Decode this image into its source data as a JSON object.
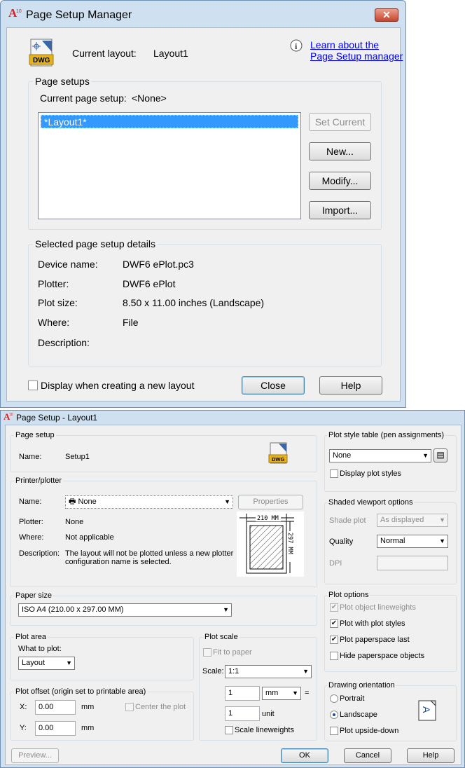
{
  "page_setup_manager": {
    "title": "Page Setup Manager",
    "close_glyph": "✕",
    "file_icon_text": "DWG",
    "current_layout_label": "Current layout:",
    "current_layout_value": "Layout1",
    "learn_link_line1": "Learn about the",
    "learn_link_line2": "Page Setup manager",
    "page_setups_legend": "Page setups",
    "current_page_setup_label": "Current page setup:",
    "current_page_setup_value": "<None>",
    "list_items": [
      "*Layout1*"
    ],
    "buttons": {
      "set_current": "Set Current",
      "new": "New...",
      "modify": "Modify...",
      "import": "Import..."
    },
    "details_legend": "Selected page setup details",
    "details": {
      "device_name_label": "Device name:",
      "device_name_value": "DWF6 ePlot.pc3",
      "plotter_label": "Plotter:",
      "plotter_value": "DWF6 ePlot",
      "plot_size_label": "Plot size:",
      "plot_size_value": "8.50 x 11.00 inches (Landscape)",
      "where_label": "Where:",
      "where_value": "File",
      "description_label": "Description:",
      "description_value": ""
    },
    "display_checkbox_label": "Display when creating a new layout",
    "close_button": "Close",
    "help_button": "Help"
  },
  "page_setup": {
    "title": "Page Setup - Layout1",
    "page_setup_group": {
      "legend": "Page setup",
      "name_label": "Name:",
      "name_value": "Setup1",
      "icon_text": "DWG"
    },
    "printer_plotter_group": {
      "legend": "Printer/plotter",
      "name_label": "Name:",
      "name_value": "None",
      "properties_button": "Properties",
      "plotter_label": "Plotter:",
      "plotter_value": "None",
      "where_label": "Where:",
      "where_value": "Not applicable",
      "description_label": "Description:",
      "description_line1": "The layout will not be plotted unless a new plotter",
      "description_line2": "configuration name is selected.",
      "preview_width": "210 MM",
      "preview_height": "297 MM"
    },
    "paper_size_group": {
      "legend": "Paper size",
      "value": "ISO A4 (210.00 x 297.00 MM)"
    },
    "plot_area_group": {
      "legend": "Plot area",
      "what_to_plot_label": "What to plot:",
      "what_to_plot_value": "Layout"
    },
    "plot_offset_group": {
      "legend": "Plot offset (origin set to printable area)",
      "x_label": "X:",
      "x_value": "0.00",
      "x_unit": "mm",
      "y_label": "Y:",
      "y_value": "0.00",
      "y_unit": "mm",
      "center_plot_label": "Center the plot"
    },
    "plot_scale_group": {
      "legend": "Plot scale",
      "fit_to_paper_label": "Fit to paper",
      "scale_label": "Scale:",
      "scale_value": "1:1",
      "top_value": "1",
      "top_unit": "mm",
      "equals": "=",
      "bottom_value": "1",
      "bottom_unit": "unit",
      "scale_lineweights_label": "Scale lineweights"
    },
    "plot_style_table_group": {
      "legend": "Plot style table (pen assignments)",
      "value": "None",
      "display_plot_styles_label": "Display plot styles"
    },
    "shaded_viewport_group": {
      "legend": "Shaded viewport options",
      "shade_plot_label": "Shade plot",
      "shade_plot_value": "As displayed",
      "quality_label": "Quality",
      "quality_value": "Normal",
      "dpi_label": "DPI",
      "dpi_value": ""
    },
    "plot_options_group": {
      "legend": "Plot options",
      "plot_object_lineweights": "Plot object lineweights",
      "plot_with_plot_styles": "Plot with plot styles",
      "plot_paperspace_last": "Plot paperspace last",
      "hide_paperspace_objects": "Hide paperspace objects"
    },
    "drawing_orientation_group": {
      "legend": "Drawing orientation",
      "portrait": "Portrait",
      "landscape": "Landscape",
      "plot_upside_down": "Plot upside-down",
      "orientation_glyph": "A"
    },
    "footer": {
      "preview": "Preview...",
      "ok": "OK",
      "cancel": "Cancel",
      "help": "Help"
    }
  }
}
